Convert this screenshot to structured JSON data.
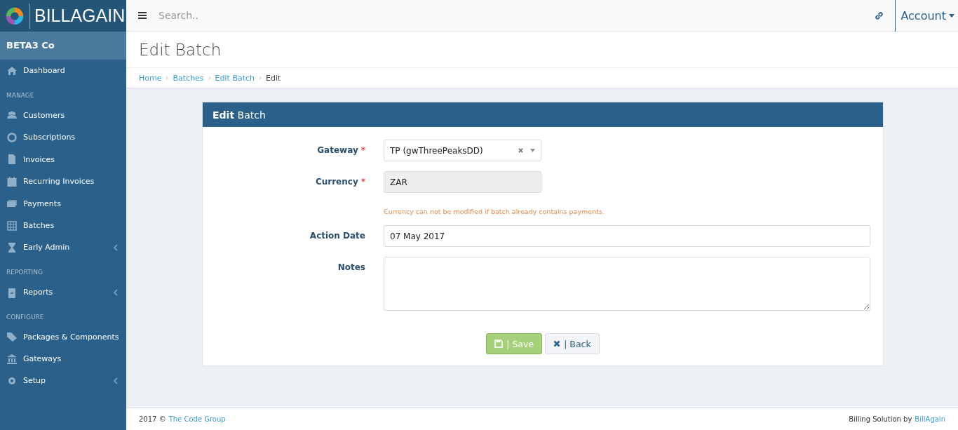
{
  "logo": {
    "text": "**BILL**AGAIN"
  },
  "topbar": {
    "search": {
      "placeholder": "Search.."
    },
    "account": "Account"
  },
  "sidebar": {
    "company": "BETA3 Co",
    "sections": [
      {
        "items": [
          {
            "label": "Dashboard",
            "has_submenu": false
          }
        ]
      },
      {
        "header": "MANAGE",
        "items": [
          {
            "label": "Customers",
            "has_submenu": false
          },
          {
            "label": "Subscriptions",
            "has_submenu": false
          },
          {
            "label": "Invoices",
            "has_submenu": false
          },
          {
            "label": "Recurring Invoices",
            "has_submenu": false
          },
          {
            "label": "Payments",
            "has_submenu": false
          },
          {
            "label": "Batches",
            "has_submenu": false
          },
          {
            "label": "Early Admin",
            "has_submenu": true
          }
        ]
      },
      {
        "header": "REPORTING",
        "items": [
          {
            "label": "Reports",
            "has_submenu": true
          }
        ]
      },
      {
        "header": "CONFIGURE",
        "items": [
          {
            "label": "Packages & Components",
            "has_submenu": false
          },
          {
            "label": "Gateways",
            "has_submenu": false
          },
          {
            "label": "Setup",
            "has_submenu": true
          }
        ]
      }
    ]
  },
  "page": {
    "title": "Edit Batch",
    "breadcrumbs": [
      {
        "label": "Home",
        "current": false
      },
      {
        "label": "Batches",
        "current": false
      },
      {
        "label": "Edit Batch",
        "current": false
      },
      {
        "label": "Edit",
        "current": true
      }
    ]
  },
  "panel": {
    "title": "**Edit** Batch",
    "fields": [
      {
        "kind": "select",
        "label": "Gateway",
        "marker": "*",
        "value": "TP (gwThreePeaksDD)"
      },
      {
        "kind": "readonly",
        "label": "Currency",
        "marker": "*",
        "value": "ZAR",
        "help": "Currency can not be modified if batch already contains payments."
      },
      {
        "kind": "text",
        "label": "Action Date",
        "value": "07 May 2017"
      },
      {
        "kind": "textarea",
        "label": "Notes"
      }
    ],
    "buttons": [
      {
        "kind": "save",
        "label": "| Save"
      },
      {
        "kind": "back",
        "label": "| Back"
      }
    ]
  },
  "footer": {
    "year": "2017 ©",
    "company_link": "The Code Group",
    "right_text": "Billing Solution by",
    "right_link": "BillAgain"
  }
}
